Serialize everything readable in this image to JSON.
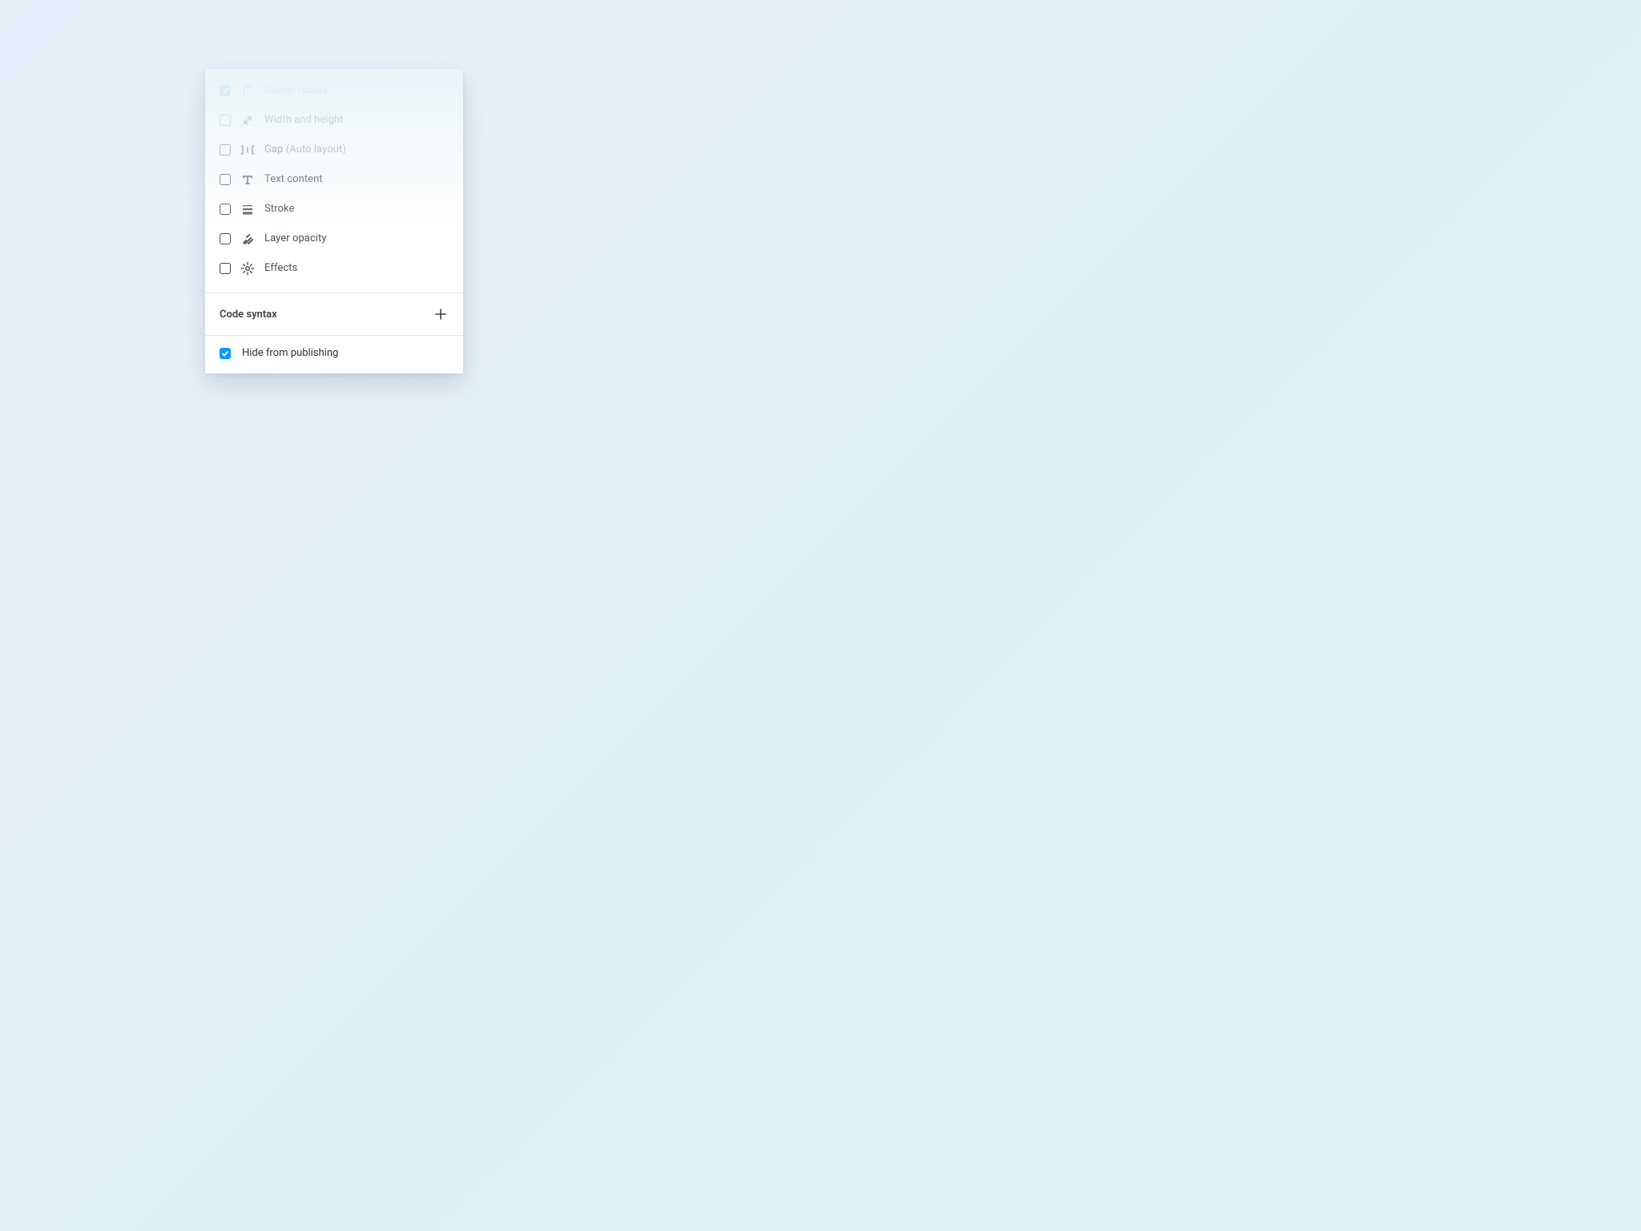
{
  "options": [
    {
      "label": "Corner radius",
      "secondary": ""
    },
    {
      "label": "Width and height",
      "secondary": ""
    },
    {
      "label": "Gap ",
      "secondary": "(Auto layout)"
    },
    {
      "label": "Text content",
      "secondary": ""
    },
    {
      "label": "Stroke",
      "secondary": ""
    },
    {
      "label": "Layer opacity",
      "secondary": ""
    },
    {
      "label": "Effects",
      "secondary": ""
    }
  ],
  "code_syntax": {
    "title": "Code syntax"
  },
  "footer": {
    "label": "Hide from publishing"
  }
}
